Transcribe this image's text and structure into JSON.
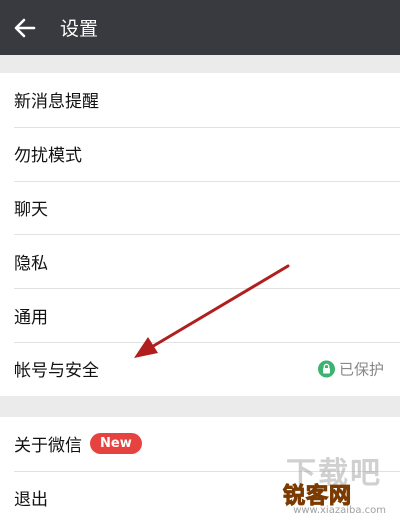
{
  "header": {
    "title": "设置",
    "back_icon": "arrow-left-icon"
  },
  "settings": {
    "items": [
      {
        "label": "新消息提醒"
      },
      {
        "label": "勿扰模式"
      },
      {
        "label": "聊天"
      },
      {
        "label": "隐私"
      },
      {
        "label": "通用"
      },
      {
        "label": "帐号与安全",
        "status": "已保护",
        "status_icon": "lock-icon"
      }
    ],
    "items2": [
      {
        "label": "关于微信",
        "badge": "New"
      },
      {
        "label": "退出"
      }
    ]
  },
  "annotation": {
    "arrow_color": "#b01e1e"
  },
  "watermark": {
    "main": "下载吧",
    "brand": "锐客网",
    "url": "www.xiazaiba.com"
  },
  "colors": {
    "topbar": "#393a3f",
    "badge": "#e64340",
    "lock": "#3cb371"
  }
}
